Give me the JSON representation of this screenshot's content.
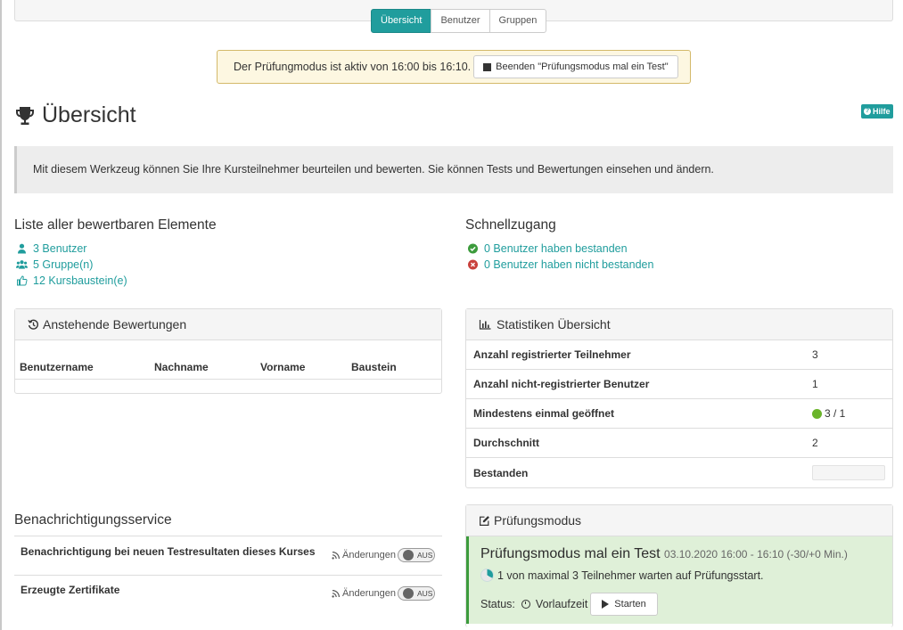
{
  "nav_tabs": [
    {
      "label": "Übersicht",
      "active": true
    },
    {
      "label": "Benutzer",
      "active": false
    },
    {
      "label": "Gruppen",
      "active": false
    }
  ],
  "exam_banner": {
    "text": "Der Prüfungmodus ist aktiv von 16:00 bis 16:10.",
    "button_label": "Beenden \"Prüfungsmodus mal ein Test\""
  },
  "page": {
    "title": "Übersicht",
    "help_label": "Hilfe",
    "info": "Mit diesem Werkzeug können Sie Ihre Kursteilnehmer beurteilen und bewerten. Sie können Tests und Bewertungen einsehen und ändern."
  },
  "assessable": {
    "heading": "Liste aller bewertbaren Elemente",
    "links": [
      "3 Benutzer",
      "5 Gruppe(n)",
      "12 Kursbaustein(e)"
    ]
  },
  "quick_access": {
    "heading": "Schnellzugang",
    "passed": "0 Benutzer haben bestanden",
    "not_passed": "0 Benutzer haben nicht bestanden"
  },
  "pending": {
    "heading": "Anstehende Bewertungen",
    "columns": [
      "Benutzername",
      "Nachname",
      "Vorname",
      "Baustein"
    ]
  },
  "stats": {
    "heading": "Statistiken Übersicht",
    "rows": [
      {
        "label": "Anzahl registrierter Teilnehmer",
        "value": "3"
      },
      {
        "label": "Anzahl nicht-registrierter Benutzer",
        "value": "1"
      },
      {
        "label": "Mindestens einmal geöffnet",
        "value": "3 / 1"
      },
      {
        "label": "Durchschnitt",
        "value": "2"
      },
      {
        "label": "Bestanden",
        "value": ""
      }
    ]
  },
  "notifications": {
    "heading": "Benachrichtigungsservice",
    "changes_label": "Änderungen",
    "toggle_label": "AUS",
    "items": [
      "Benachrichtigung bei neuen Testresultaten dieses Kurses",
      "Erzeugte Zertifikate"
    ]
  },
  "exam_mode": {
    "heading": "Prüfungsmodus",
    "name": "Prüfungsmodus mal ein Test",
    "date": "03.10.2020 16:00 - 16:10 (-30/+0 Min.)",
    "waiting": "1 von maximal 3 Teilnehmer warten auf Prüfungsstart.",
    "status_label": "Status:",
    "status_value": "Vorlaufzeit",
    "start_label": "Starten"
  },
  "colors": {
    "accent": "#209d9d",
    "success": "#3c9b3c",
    "warning_bg": "#fdf7e1"
  }
}
